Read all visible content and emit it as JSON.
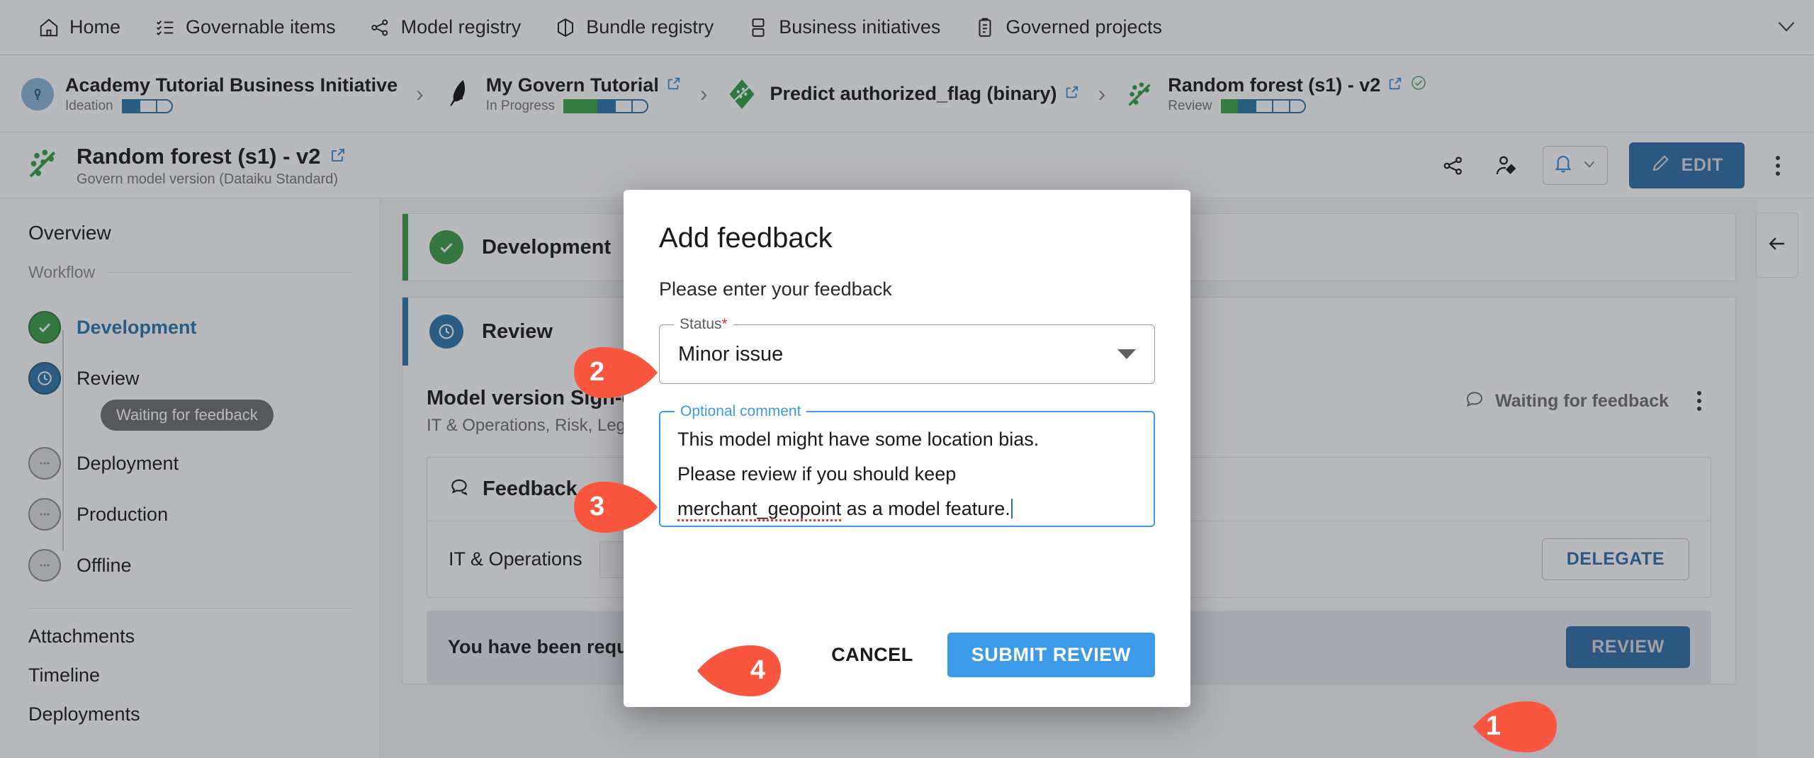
{
  "topnav": {
    "items": [
      {
        "label": "Home",
        "icon": "home-icon"
      },
      {
        "label": "Governable items",
        "icon": "checklist-icon"
      },
      {
        "label": "Model registry",
        "icon": "model-nodes-icon"
      },
      {
        "label": "Bundle registry",
        "icon": "cube-icon"
      },
      {
        "label": "Business initiatives",
        "icon": "initiatives-icon"
      },
      {
        "label": "Governed projects",
        "icon": "clipboard-icon"
      }
    ],
    "expand_icon": "chevron-down-icon"
  },
  "breadcrumb": {
    "items": [
      {
        "title": "Academy Tutorial Business Initiative",
        "status": "Ideation",
        "icon": "lightbulb-icon",
        "pips": [
          "blue",
          "empty",
          "empty"
        ],
        "external_link": false
      },
      {
        "title": "My Govern Tutorial",
        "status": "In Progress",
        "icon": "govern-feather-icon",
        "pips": [
          "green",
          "green",
          "blue",
          "empty",
          "empty"
        ],
        "external_link": true
      },
      {
        "title": "Predict authorized_flag (binary)",
        "status": "",
        "icon": "green-diamond-icon",
        "pips": [],
        "external_link": true
      },
      {
        "title": "Random forest (s1) - v2",
        "status": "Review",
        "icon": "scatter-model-icon",
        "pips": [
          "green",
          "blue",
          "empty",
          "empty",
          "empty"
        ],
        "external_link": true,
        "check_icon": true
      }
    ],
    "separator": "›"
  },
  "page_header": {
    "title": "Random forest (s1) - v2",
    "subtitle": "Govern model version (Dataiku Standard)",
    "icon": "scatter-model-icon",
    "external_link_icon": "external-link-icon",
    "actions": {
      "share_icon": "share-nodes-icon",
      "user_tag_icon": "user-tag-icon",
      "bell_icon": "bell-icon",
      "bell_caret_icon": "chevron-down-icon",
      "edit_label": "EDIT",
      "edit_icon": "pencil-icon",
      "more_icon": "kebab-menu-icon"
    }
  },
  "sidebar": {
    "overview": "Overview",
    "workflow_label": "Workflow",
    "workflow": [
      {
        "label": "Development",
        "state": "done",
        "active": true,
        "chip": null
      },
      {
        "label": "Review",
        "state": "current",
        "active": false,
        "chip": "Waiting for feedback"
      },
      {
        "label": "Deployment",
        "state": "pending",
        "active": false,
        "chip": null
      },
      {
        "label": "Production",
        "state": "pending",
        "active": false,
        "chip": null
      },
      {
        "label": "Offline",
        "state": "pending",
        "active": false,
        "chip": null
      }
    ],
    "links": [
      "Attachments",
      "Timeline",
      "Deployments"
    ]
  },
  "main": {
    "development_card": {
      "title": "Development",
      "state": "done"
    },
    "review_card": {
      "title": "Review",
      "state": "current"
    },
    "signoff": {
      "title": "Model version Sign-off",
      "subtitle": "IT & Operations, Risk, Legal and Compliance, Business Direction",
      "status_label": "Waiting for feedback",
      "status_icon": "comment-icon",
      "more_icon": "kebab-menu-icon"
    },
    "feedback": {
      "header": "Feedback",
      "header_icon": "comments-icon",
      "row_label": "IT & Operations",
      "delegate_label": "DELEGATE"
    },
    "notice": {
      "text": "You have been requested to review this object.",
      "review_label": "REVIEW"
    },
    "collapse_icon": "arrow-left-icon"
  },
  "modal": {
    "title": "Add feedback",
    "description": "Please enter your feedback",
    "status_field": {
      "legend": "Status",
      "required_marker": "*",
      "value": "Minor issue",
      "caret_icon": "caret-down-icon"
    },
    "comment_field": {
      "legend": "Optional comment",
      "lines": [
        "This model might have some location bias.",
        "Please review if you should keep",
        "merchant_geopoint as a model feature."
      ],
      "misspelled_word": "merchant_geopoint"
    },
    "cancel_label": "CANCEL",
    "submit_label": "SUBMIT REVIEW"
  },
  "callouts": [
    {
      "number": "1",
      "target": "review-button"
    },
    {
      "number": "2",
      "target": "status-field"
    },
    {
      "number": "3",
      "target": "comment-field"
    },
    {
      "number": "4",
      "target": "submit-review-button"
    }
  ],
  "colors": {
    "accent_blue": "#2e6ea6",
    "modal_blue": "#3d9ae8",
    "green": "#3d9c48",
    "callout_red": "#f9553f",
    "required_red": "#d03a2c"
  }
}
